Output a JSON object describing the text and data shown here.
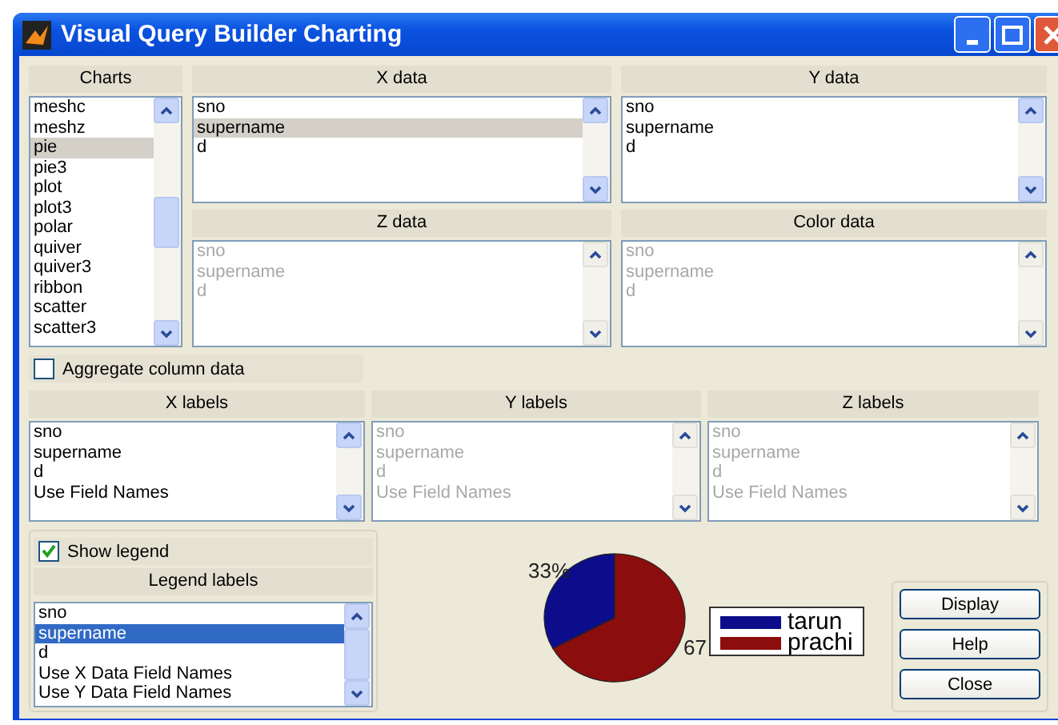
{
  "window": {
    "title": "Visual Query Builder Charting"
  },
  "charts": {
    "heading": "Charts",
    "disabled": false,
    "items": [
      {
        "label": "meshc",
        "selected": false
      },
      {
        "label": "meshz",
        "selected": false
      },
      {
        "label": "pie",
        "selected": true
      },
      {
        "label": "pie3",
        "selected": false
      },
      {
        "label": "plot",
        "selected": false
      },
      {
        "label": "plot3",
        "selected": false
      },
      {
        "label": "polar",
        "selected": false
      },
      {
        "label": "quiver",
        "selected": false
      },
      {
        "label": "quiver3",
        "selected": false
      },
      {
        "label": "ribbon",
        "selected": false
      },
      {
        "label": "scatter",
        "selected": false
      },
      {
        "label": "scatter3",
        "selected": false
      }
    ]
  },
  "x_data": {
    "heading": "X data",
    "disabled": false,
    "items": [
      {
        "label": "sno",
        "selected": false
      },
      {
        "label": "supername",
        "selected": true
      },
      {
        "label": "d",
        "selected": false
      }
    ]
  },
  "y_data": {
    "heading": "Y data",
    "disabled": false,
    "items": [
      {
        "label": "sno",
        "selected": false
      },
      {
        "label": "supername",
        "selected": false
      },
      {
        "label": "d",
        "selected": false
      }
    ]
  },
  "z_data": {
    "heading": "Z data",
    "disabled": true,
    "items": [
      {
        "label": "sno",
        "selected": false
      },
      {
        "label": "supername",
        "selected": false
      },
      {
        "label": "d",
        "selected": false
      }
    ]
  },
  "color_data": {
    "heading": "Color data",
    "disabled": true,
    "items": [
      {
        "label": "sno",
        "selected": false
      },
      {
        "label": "supername",
        "selected": false
      },
      {
        "label": "d",
        "selected": false
      }
    ]
  },
  "aggregate": {
    "label": "Aggregate column data",
    "checked": false
  },
  "x_labels": {
    "heading": "X labels",
    "disabled": false,
    "items": [
      {
        "label": "sno",
        "selected": false
      },
      {
        "label": "supername",
        "selected": false
      },
      {
        "label": "d",
        "selected": false
      },
      {
        "label": "Use Field Names",
        "selected": false
      }
    ]
  },
  "y_labels": {
    "heading": "Y labels",
    "disabled": true,
    "items": [
      {
        "label": "sno",
        "selected": false
      },
      {
        "label": "supername",
        "selected": false
      },
      {
        "label": "d",
        "selected": false
      },
      {
        "label": "Use Field Names",
        "selected": false
      }
    ]
  },
  "z_labels": {
    "heading": "Z labels",
    "disabled": true,
    "items": [
      {
        "label": "sno",
        "selected": false
      },
      {
        "label": "supername",
        "selected": false
      },
      {
        "label": "d",
        "selected": false
      },
      {
        "label": "Use Field Names",
        "selected": false
      }
    ]
  },
  "show_legend": {
    "label": "Show legend",
    "checked": true
  },
  "legend_labels": {
    "heading": "Legend labels",
    "disabled": false,
    "focused": true,
    "items": [
      {
        "label": "sno",
        "selected": false
      },
      {
        "label": "supername",
        "selected": true
      },
      {
        "label": "d",
        "selected": false
      },
      {
        "label": "Use X Data Field Names",
        "selected": false
      },
      {
        "label": "Use Y Data Field Names",
        "selected": false
      }
    ]
  },
  "preview": {
    "chart_data": {
      "type": "pie",
      "categories": [
        "tarun",
        "prachi"
      ],
      "series": [
        {
          "values": [
            33,
            67
          ]
        }
      ],
      "colors": [
        "#0d0d8c",
        "#8b0d0d"
      ],
      "value_labels": [
        "33%",
        "67"
      ]
    }
  },
  "buttons": [
    "Display",
    "Help",
    "Close"
  ]
}
